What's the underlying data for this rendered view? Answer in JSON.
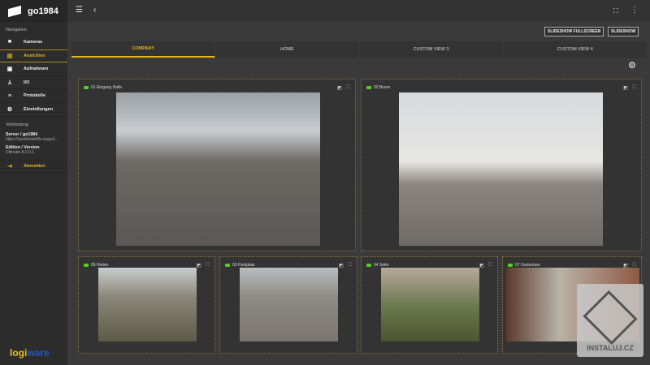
{
  "app": {
    "title": "go1984"
  },
  "sidebar": {
    "nav_heading": "Navigation",
    "items": [
      {
        "label": "Kameras",
        "icon": "camera-icon"
      },
      {
        "label": "Ansichten",
        "icon": "views-icon"
      },
      {
        "label": "Aufnahmen",
        "icon": "recordings-icon"
      },
      {
        "label": "I/O",
        "icon": "io-icon"
      },
      {
        "label": "Protokolle",
        "icon": "log-icon"
      },
      {
        "label": "Einstellungen",
        "icon": "gear-icon"
      }
    ],
    "conn_heading": "Verbindung",
    "server_label": "Server / go1984",
    "server_url": "https://sundenstoffis.mygo1...",
    "edition_label": "Edition / Version",
    "edition_value": "Ultimate  8.0.0.1",
    "logout": "Abmelden",
    "logo_a": "logi",
    "logo_b": "ware"
  },
  "toolbar": {
    "slideshow_fullscreen": "SLIDESHOW FULLSCREEN",
    "slideshow": "SLIDESHOW"
  },
  "tabs": [
    "COMPANY",
    "HOME",
    "CUSTOM VIEW 3",
    "CUSTOM VIEW 4"
  ],
  "cameras": [
    "01 Eingang Halle",
    "02 Buero",
    "05 Hinten",
    "03 Parkplatz",
    "04 Seite",
    "07 Gartentuer"
  ],
  "watermark": "INSTALUJ.CZ"
}
